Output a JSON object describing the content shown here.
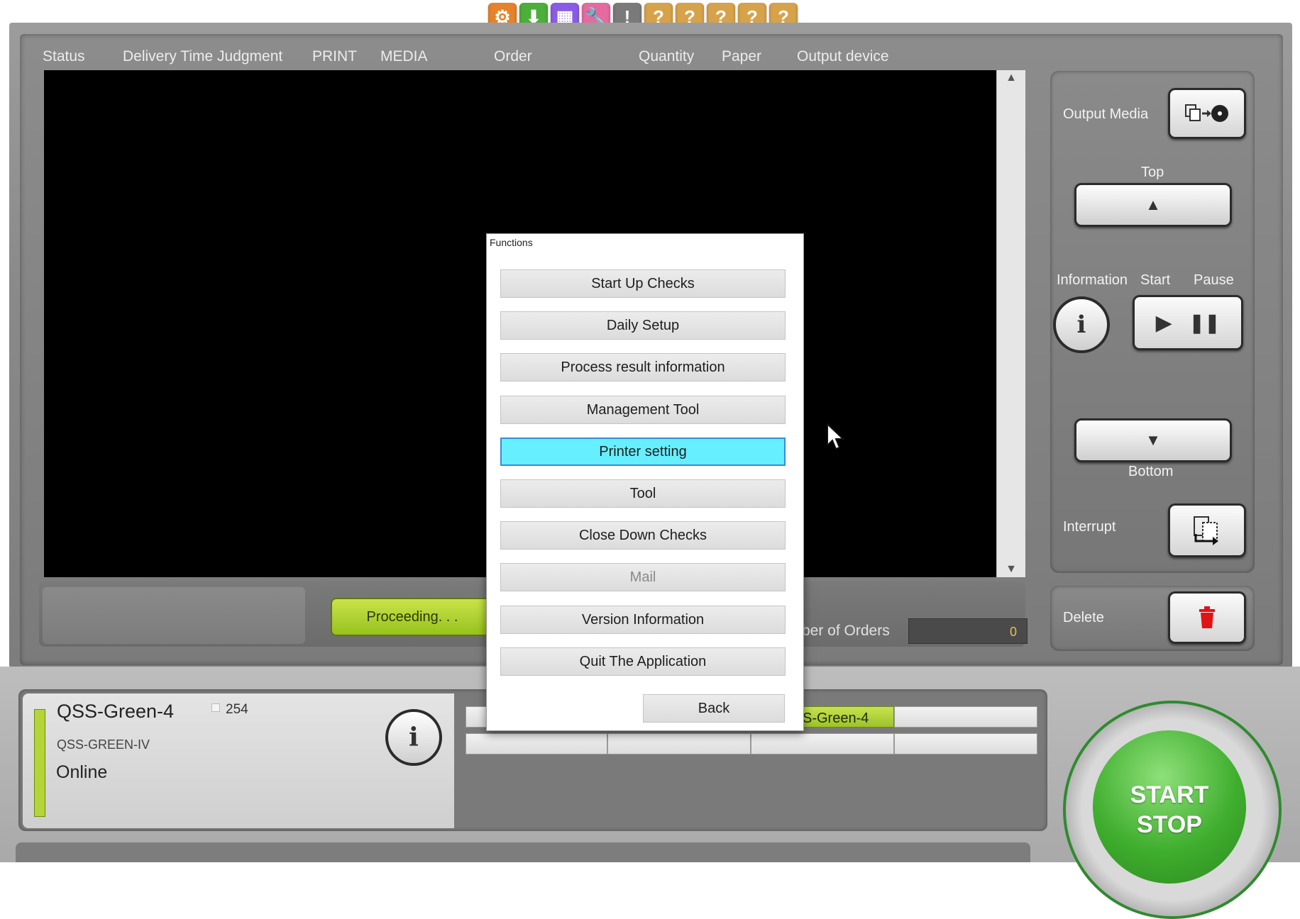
{
  "toolbar": {
    "icons": [
      {
        "name": "tools-bag-icon",
        "color": "#e6822a",
        "glyph": "⚙"
      },
      {
        "name": "download-icon",
        "color": "#4caf3a",
        "glyph": "⬇"
      },
      {
        "name": "calendar-icon",
        "color": "#8a5ce6",
        "glyph": "▦"
      },
      {
        "name": "wrench-icon",
        "color": "#e46aa0",
        "glyph": "🔧"
      },
      {
        "name": "alert-icon",
        "color": "#7a7a7a",
        "glyph": "!"
      },
      {
        "name": "help-icon-1",
        "color": "#d6a24a",
        "glyph": "?"
      },
      {
        "name": "help-icon-2",
        "color": "#d6a24a",
        "glyph": "?"
      },
      {
        "name": "help-icon-3",
        "color": "#d6a24a",
        "glyph": "?"
      },
      {
        "name": "help-icon-4",
        "color": "#d6a24a",
        "glyph": "?"
      },
      {
        "name": "help-icon-5",
        "color": "#d6a24a",
        "glyph": "?"
      }
    ]
  },
  "columns": {
    "status": "Status",
    "delivery": "Delivery Time Judgment",
    "print": "PRINT",
    "media": "MEDIA",
    "order": "Order",
    "quantity": "Quantity",
    "paper": "Paper",
    "output": "Output device"
  },
  "queue": {
    "proceeding_label": "Proceeding. . .",
    "orders_label": "ber of Orders",
    "orders_value": "0"
  },
  "right_panel": {
    "output_media": "Output Media",
    "top": "Top",
    "information": "Information",
    "start": "Start",
    "pause": "Pause",
    "bottom": "Bottom",
    "interrupt": "Interrupt",
    "delete": "Delete"
  },
  "device": {
    "name": "QSS-Green-4",
    "count": "254",
    "model": "QSS-GREEN-IV",
    "status": "Online",
    "tab_label": "S-Green-4",
    "accent_color": "#b6d33a"
  },
  "start_stop": {
    "line1": "START",
    "line2": "STOP"
  },
  "dialog": {
    "title": "Functions",
    "buttons": [
      "Start Up Checks",
      "Daily Setup",
      "Process result information",
      "Management Tool",
      "Printer setting",
      "Tool",
      "Close Down Checks",
      "Mail",
      "Version Information",
      "Quit The Application"
    ],
    "active_index": 4,
    "disabled_index": 7,
    "back": "Back"
  }
}
